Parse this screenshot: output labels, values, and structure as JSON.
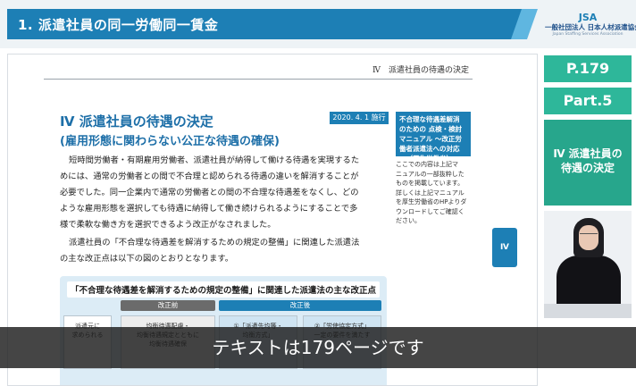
{
  "header": {
    "title": "1. 派遣社員の同一労働同一賃金",
    "logo_mark": "JSA",
    "logo_name": "一般社団法人 日本人材派遣協会",
    "logo_sub": "Japan Staffing Services Association"
  },
  "page": {
    "running_head": "Ⅳ　派遣社員の待遇の決定",
    "section_title": "Ⅳ 派遣社員の待遇の決定",
    "section_subtitle": "(雇用形態に関わらない公正な待遇の確保)",
    "date_badge": "2020. 4. 1 施行",
    "paragraph1": "短時間労働者・有期雇用労働者、派遣社員が納得して働ける待遇を実現するた\nめには、通常の労働者との間で不合理と認められる待遇の違いを解消することが\n必要でした。同一企業内で通常の労働者との間の不合理な待遇差をなくし、どの\nような雇用形態を選択しても待遇に納得して働き続けられるようにすることで多\n様で柔軟な働き方を選択できるよう改正がなされました。",
    "paragraph2": "派遣社員の「不合理な待遇差を解消するための規定の整備」に関連した派遣法\nの主な改正点は以下の図のとおりとなります。",
    "side_box": "不合理な待遇差解消\nのための 点検・検討\nマニュアル ～改正労\n働者派遣法への対応\n～（厚生労働省）",
    "side_note": "ここでの内容は上記マ\nニュアルの一部抜粋した\nものを掲載しています。\n詳しくは上記マニュアル\nを厚生労働省のHPよりダ\nウンロードしてご確認く\nださい。",
    "chapter_tab": "Ⅳ",
    "diagram": {
      "title": "「不合理な待遇差を解消するための規定の整備」に関連した派遣法の主な改正点",
      "before_label": "改正前",
      "after_label": "改正後",
      "cells": [
        "派遣元に\n求められる",
        "均衡待遇配慮・\n均衡待遇規定とともに\n均衡待遇確保",
        "①「派遣先均等・\n均衡方式」",
        "②「労使協定方式」\n一定の要件を満たす"
      ]
    }
  },
  "sidebar": {
    "page_label": "P.179",
    "part_label": "Part.5",
    "chapter_label": "Ⅳ 派遣社員の\n待遇の決定"
  },
  "caption": {
    "text": "テキストは179ページです"
  }
}
